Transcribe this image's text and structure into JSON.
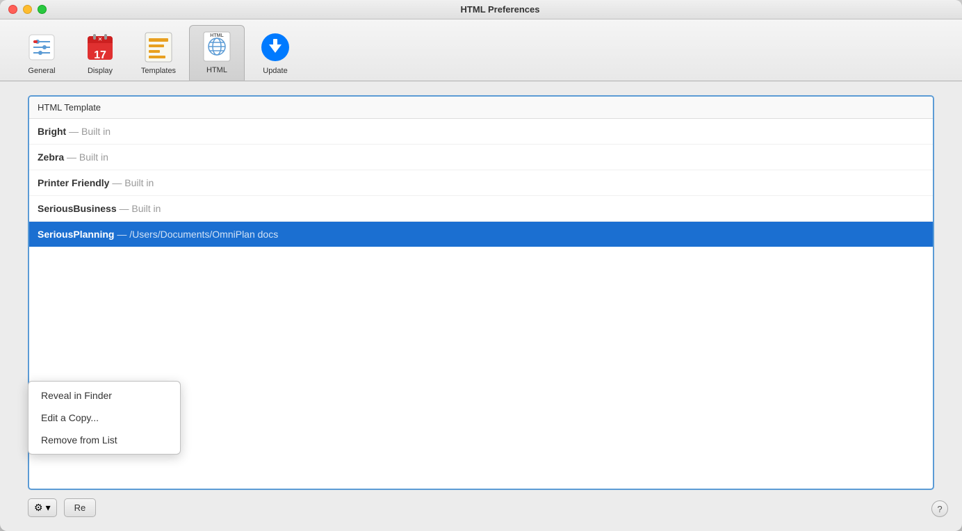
{
  "window": {
    "title": "HTML Preferences"
  },
  "toolbar": {
    "items": [
      {
        "id": "general",
        "label": "General",
        "active": false
      },
      {
        "id": "display",
        "label": "Display",
        "active": false
      },
      {
        "id": "templates",
        "label": "Templates",
        "active": false
      },
      {
        "id": "html",
        "label": "HTML",
        "active": true
      },
      {
        "id": "update",
        "label": "Update",
        "active": false
      }
    ]
  },
  "list": {
    "header": "HTML Template",
    "items": [
      {
        "name": "Bright",
        "subtitle": "— Built in",
        "selected": false
      },
      {
        "name": "Zebra",
        "subtitle": "— Built in",
        "selected": false
      },
      {
        "name": "Printer Friendly",
        "subtitle": "— Built in",
        "selected": false
      },
      {
        "name": "SeriousBusiness",
        "subtitle": "— Built in",
        "selected": false
      },
      {
        "name": "SeriousPlanning",
        "subtitle": "— /Users/Documents/OmniPlan docs",
        "selected": true
      }
    ]
  },
  "gear_button": {
    "label": "⚙",
    "chevron": "▾"
  },
  "dropdown": {
    "items": [
      {
        "label": "Reveal in Finder"
      },
      {
        "label": "Edit a Copy..."
      },
      {
        "label": "Remove from List"
      }
    ]
  },
  "restore_button": {
    "label": "Re"
  },
  "help_button": {
    "label": "?"
  }
}
